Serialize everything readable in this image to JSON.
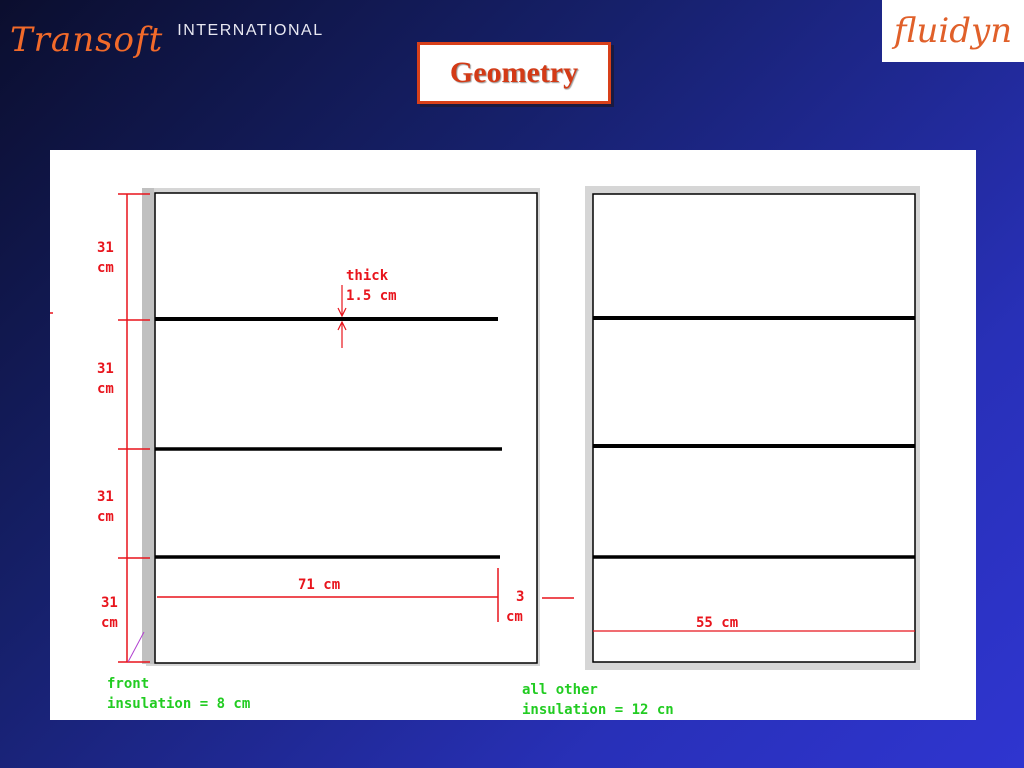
{
  "header": {
    "brand_script": "Transoft",
    "brand_sub": "INTERNATIONAL",
    "partner_logo": "fluidyn",
    "title": "Geometry"
  },
  "diagram": {
    "left_view": {
      "shelf_heights": [
        {
          "value": "31",
          "unit": "cm"
        },
        {
          "value": "31",
          "unit": "cm"
        },
        {
          "value": "31",
          "unit": "cm"
        },
        {
          "value": "31",
          "unit": "cm"
        }
      ],
      "thickness_label": "thick",
      "thickness_value": "1.5 cm",
      "width_label": "71 cm",
      "gap_value": "3",
      "gap_unit": "cm",
      "note_line1": "front",
      "note_line2": "insulation = 8 cm"
    },
    "right_view": {
      "width_label": "55 cm",
      "note_line1": "all other",
      "note_line2": "insulation =  12 cn"
    },
    "colors": {
      "dimension": "#e8141c",
      "note": "#22cc22",
      "shelf": "#000000",
      "wall": "#c0c0c0"
    }
  }
}
